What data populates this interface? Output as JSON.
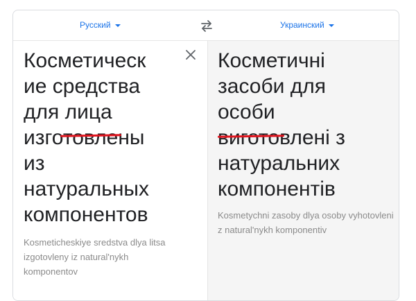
{
  "source": {
    "language": "Русский",
    "lines": [
      "Косметическ",
      "ие средства",
      "для лица",
      "изготовлены",
      "из",
      "натуральных",
      "компонентов"
    ],
    "transliteration": "Kosmeticheskiye sredstva dlya litsa izgotovleny iz natural'nykh komponentov"
  },
  "target": {
    "language": "Украинский",
    "lines": [
      "Косметичні",
      "засоби для",
      "особи",
      "виготовлені з",
      "натуральних",
      "компонентів"
    ],
    "transliteration": "Kosmetychni zasoby dlya osoby vyhotovleni z natural'nykh komponentiv"
  },
  "icons": {
    "swap": "swap-arrows-icon",
    "close": "close-icon",
    "dropdown": "caret-down-icon"
  },
  "colors": {
    "accent": "#1a73e8",
    "annotation": "#e0141e",
    "target_bg": "#f5f5f5"
  }
}
